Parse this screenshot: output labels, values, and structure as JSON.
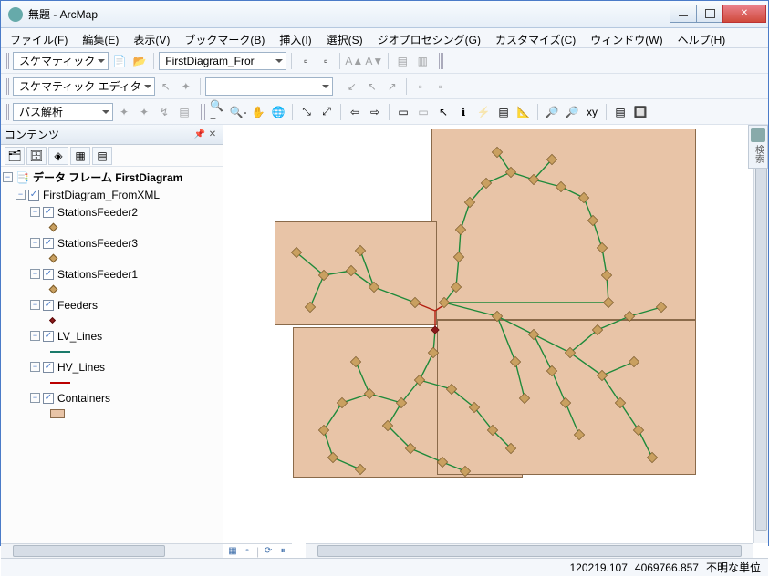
{
  "window": {
    "title": "無題 - ArcMap"
  },
  "menu": {
    "file": "ファイル(F)",
    "edit": "編集(E)",
    "view": "表示(V)",
    "bookmarks": "ブックマーク(B)",
    "insert": "挿入(I)",
    "selection": "選択(S)",
    "geoprocessing": "ジオプロセシング(G)",
    "customize": "カスタマイズ(C)",
    "window": "ウィンドウ(W)",
    "help": "ヘルプ(H)"
  },
  "toolbarA": {
    "label": "スケマティック",
    "dd": "FirstDiagram_Fror"
  },
  "toolbarB": {
    "label": "スケマティック エディタ"
  },
  "toolbarC": {
    "label": "パス解析"
  },
  "toc": {
    "title": "コンテンツ",
    "root": "データ フレーム FirstDiagram",
    "nodes": [
      {
        "label": "FirstDiagram_FromXML"
      },
      {
        "label": "StationsFeeder2",
        "sym": "dia"
      },
      {
        "label": "StationsFeeder3",
        "sym": "dia"
      },
      {
        "label": "StationsFeeder1",
        "sym": "dia"
      },
      {
        "label": "Feeders",
        "sym": "dia-red"
      },
      {
        "label": "LV_Lines",
        "sym": "line"
      },
      {
        "label": "HV_Lines",
        "sym": "line-red"
      },
      {
        "label": "Containers",
        "sym": "rect"
      }
    ]
  },
  "sidedock": {
    "label": "検索"
  },
  "status": {
    "x": "120219.107",
    "y": "4069766.857",
    "units": "不明な単位"
  }
}
